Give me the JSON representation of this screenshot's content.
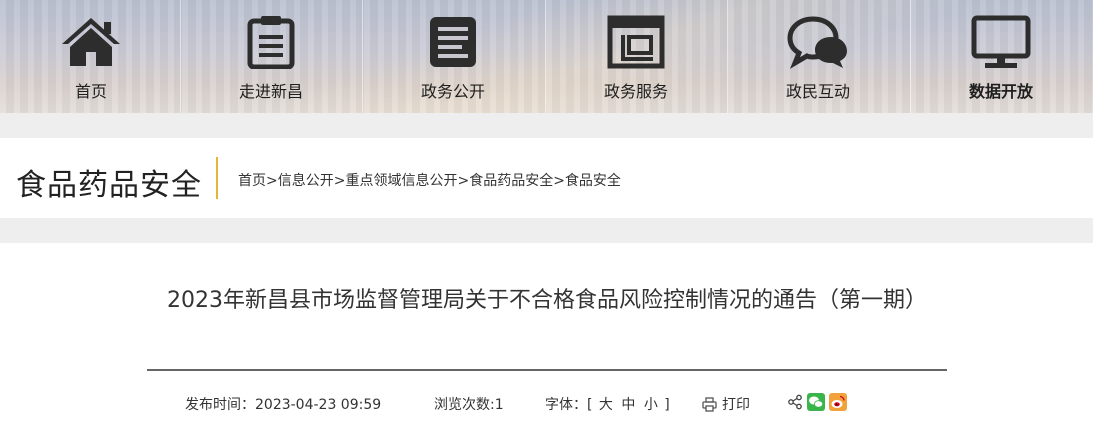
{
  "nav": {
    "items": [
      {
        "label": "首页",
        "icon": "home-icon"
      },
      {
        "label": "走进新昌",
        "icon": "document-list-icon"
      },
      {
        "label": "政务公开",
        "icon": "news-icon"
      },
      {
        "label": "政务服务",
        "icon": "service-building-icon"
      },
      {
        "label": "政民互动",
        "icon": "chat-bubbles-icon"
      },
      {
        "label": "数据开放",
        "icon": "monitor-icon"
      }
    ]
  },
  "section": {
    "title": "食品药品安全",
    "accent_color": "#e8b23c"
  },
  "breadcrumb": {
    "items": [
      "首页",
      "信息公开",
      "重点领域信息公开",
      "食品药品安全",
      "食品安全"
    ],
    "separator": ">"
  },
  "article": {
    "title": "2023年新昌县市场监督管理局关于不合格食品风险控制情况的通告（第一期）",
    "publish_label": "发布时间：2023-04-23 09:59",
    "views_label": "浏览次数:1",
    "font_label": "字体：[",
    "font_large": "大",
    "font_medium": "中",
    "font_small": "小",
    "font_close": "]",
    "print_label": "打印",
    "share_icons": [
      "share-icon",
      "wechat-icon",
      "weibo-icon"
    ]
  }
}
